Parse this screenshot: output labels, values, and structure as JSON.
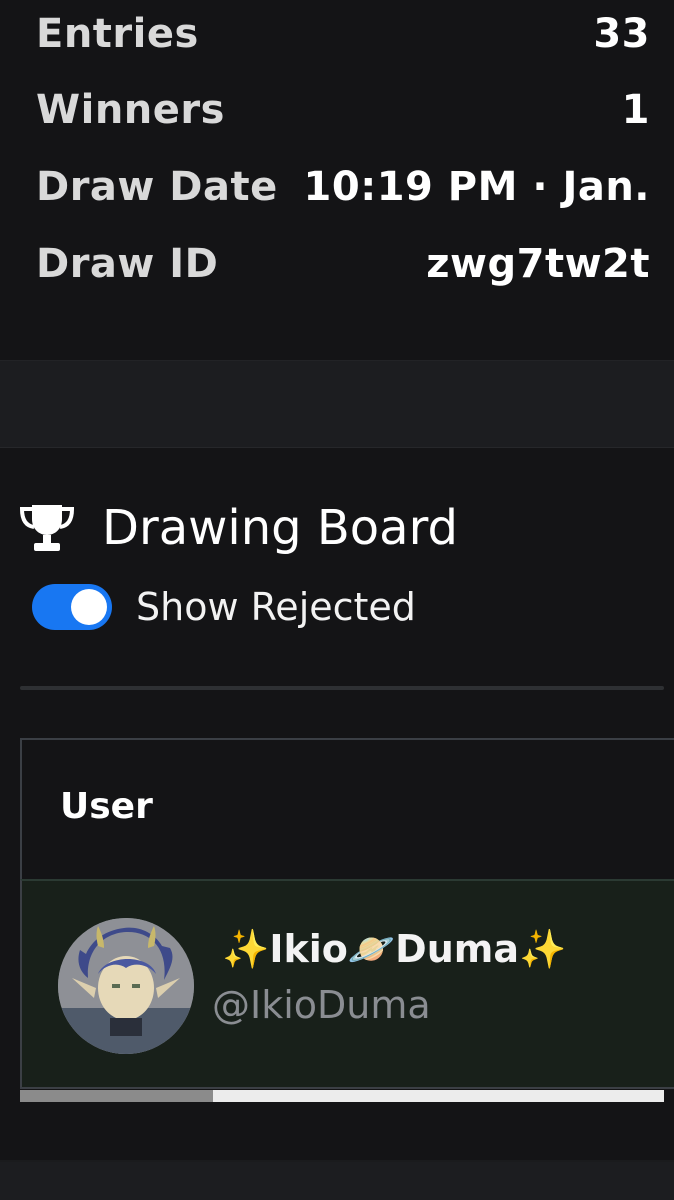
{
  "stats": [
    {
      "label": "Entries",
      "value": "33"
    },
    {
      "label": "Winners",
      "value": "1"
    },
    {
      "label": "Draw Date",
      "value": "10:19 PM · Jan."
    },
    {
      "label": "Draw ID",
      "value": "zwg7tw2t"
    }
  ],
  "board": {
    "title": "Drawing Board",
    "icon": "trophy-icon",
    "toggle_label": "Show Rejected",
    "toggle_on": true,
    "accent_color": "#1877f2"
  },
  "table": {
    "columns": [
      "User"
    ],
    "rows": [
      {
        "name": "✨Ikio🪐Duma✨",
        "handle": "@IkioDuma",
        "avatar": "avatar-image"
      }
    ]
  },
  "scroll": {
    "thumb_fraction": 0.3
  }
}
